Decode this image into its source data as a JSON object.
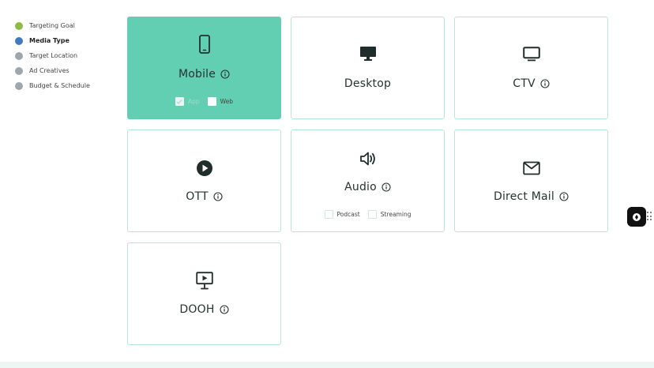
{
  "steps": [
    {
      "label": "Targeting Goal",
      "state": "done"
    },
    {
      "label": "Media Type",
      "state": "active"
    },
    {
      "label": "Target Location",
      "state": "pending"
    },
    {
      "label": "Ad Creatives",
      "state": "pending"
    },
    {
      "label": "Budget & Schedule",
      "state": "pending"
    }
  ],
  "cards": {
    "mobile": {
      "title": "Mobile",
      "options": [
        {
          "label": "App",
          "checked": true
        },
        {
          "label": "Web",
          "checked": false
        }
      ]
    },
    "desktop": {
      "title": "Desktop"
    },
    "ctv": {
      "title": "CTV"
    },
    "ott": {
      "title": "OTT"
    },
    "audio": {
      "title": "Audio",
      "options": [
        {
          "label": "Podcast",
          "checked": false
        },
        {
          "label": "Streaming",
          "checked": false
        }
      ]
    },
    "directmail": {
      "title": "Direct Mail"
    },
    "dooh": {
      "title": "DOOH"
    }
  },
  "colors": {
    "accent": "#62cfb2",
    "card_border": "#b9e6da",
    "step_done": "#8dbb45",
    "step_active": "#3f7bc0",
    "step_pending": "#9ea7ad"
  },
  "icons": {
    "mobile": "smartphone-icon",
    "desktop": "monitor-icon",
    "ctv": "tv-icon",
    "ott": "play-circle-icon",
    "audio": "speaker-icon",
    "directmail": "envelope-icon",
    "dooh": "billboard-play-icon"
  }
}
